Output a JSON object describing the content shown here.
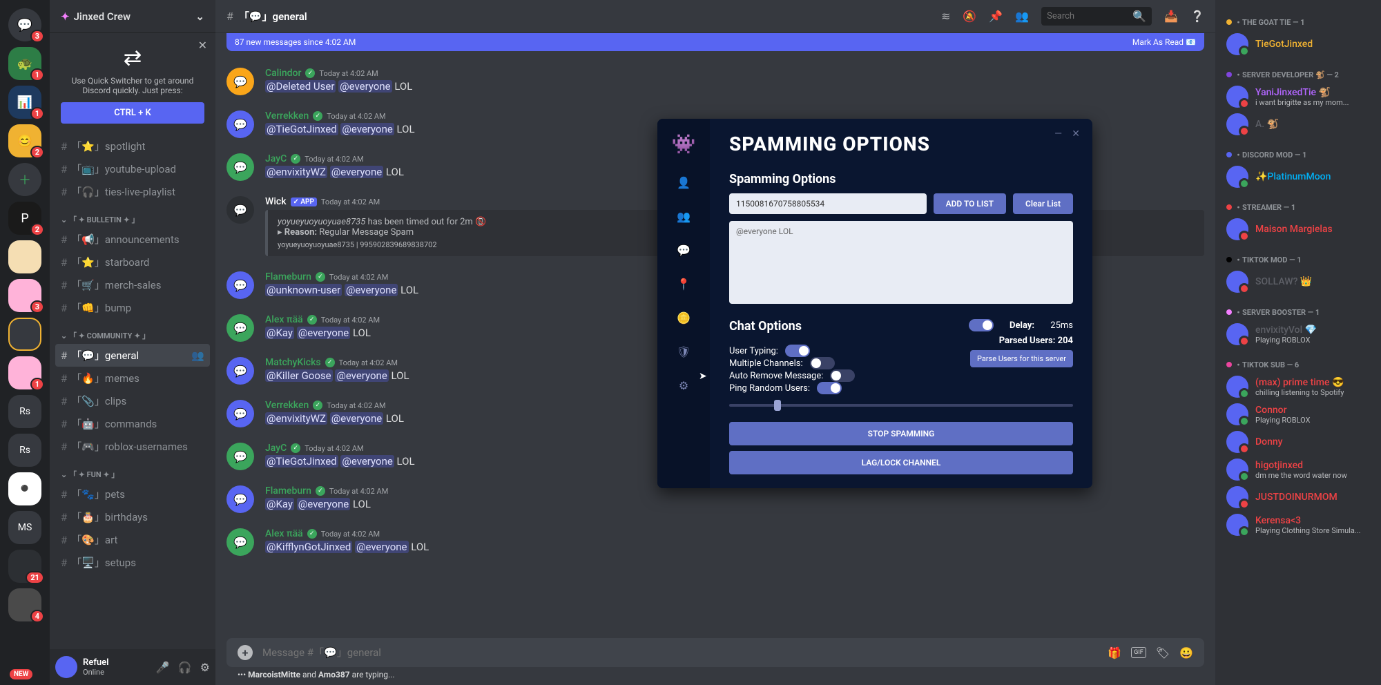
{
  "server_name": "Jinxed Crew",
  "quick_switcher": {
    "text": "Use Quick Switcher to get around Discord quickly. Just press:",
    "button": "CTRL + K"
  },
  "channels": {
    "top": [
      {
        "icon": "⭐",
        "name": "spotlight"
      },
      {
        "icon": "📺",
        "name": "youtube-upload"
      },
      {
        "icon": "🎧",
        "name": "ties-live-playlist"
      }
    ],
    "categories": [
      {
        "name": "「 ✦ BULLETIN ✦ 」",
        "items": [
          {
            "icon": "📢",
            "name": "announcements"
          },
          {
            "icon": "⭐",
            "name": "starboard"
          },
          {
            "icon": "🛒",
            "name": "merch-sales"
          },
          {
            "icon": "👊",
            "name": "bump"
          }
        ]
      },
      {
        "name": "「 ✦ COMMUNITY ✦ 」",
        "items": [
          {
            "icon": "💬",
            "name": "general",
            "active": true
          },
          {
            "icon": "🔥",
            "name": "memes"
          },
          {
            "icon": "📎",
            "name": "clips"
          },
          {
            "icon": "🤖",
            "name": "commands"
          },
          {
            "icon": "🎮",
            "name": "roblox-usernames"
          }
        ]
      },
      {
        "name": "「 ✦ FUN ✦ 」",
        "items": [
          {
            "icon": "🐾",
            "name": "pets"
          },
          {
            "icon": "🎂",
            "name": "birthdays"
          },
          {
            "icon": "🎨",
            "name": "art"
          },
          {
            "icon": "🖥️",
            "name": "setups"
          }
        ]
      }
    ]
  },
  "current_user": {
    "name": "Refuel",
    "status": "Online"
  },
  "channel_header": {
    "prefix": "#",
    "title": "「💬」general"
  },
  "search_placeholder": "Search",
  "new_messages": {
    "text": "87 new messages since 4:02 AM",
    "action": "Mark As Read"
  },
  "messages": [
    {
      "author": "Calindor",
      "color": "#3ba55c",
      "time": "Today at 4:02 AM",
      "mentions": [
        "@Deleted User",
        "@everyone"
      ],
      "text": "LOL",
      "avatar": "#faa61a"
    },
    {
      "author": "Verrekken",
      "color": "#3ba55c",
      "time": "Today at 4:02 AM",
      "mentions": [
        "@TieGotJinxed",
        "@everyone"
      ],
      "text": "LOL",
      "avatar": "#5865f2"
    },
    {
      "author": "JayC",
      "color": "#3ba55c",
      "time": "Today at 4:02 AM",
      "mentions": [
        "@envixityWZ",
        "@everyone"
      ],
      "text": "LOL",
      "avatar": "#3ba55c"
    },
    {
      "author": "Wick",
      "color": "#fff",
      "time": "Today at 4:02 AM",
      "app": true,
      "embed": {
        "line1_italic": "yoyueyuoyuoyuae8735",
        "line1_rest": " has been timed out for 2m 📵",
        "reason_label": "Reason:",
        "reason": " Regular Message Spam",
        "footer": "yoyueyuoyuoyuae8735 | 995902839689838702"
      },
      "avatar": "#2c2f33"
    },
    {
      "author": "Flameburn",
      "color": "#3ba55c",
      "time": "Today at 4:02 AM",
      "mentions": [
        "@unknown-user",
        "@everyone"
      ],
      "text": "LOL",
      "avatar": "#5865f2"
    },
    {
      "author": "Alex πää",
      "color": "#3ba55c",
      "time": "Today at 4:02 AM",
      "mentions": [
        "@Kay",
        "@everyone"
      ],
      "text": "LOL",
      "avatar": "#3ba55c"
    },
    {
      "author": "MatchyKicks",
      "color": "#3ba55c",
      "time": "Today at 4:02 AM",
      "mentions": [
        "@Killer Goose",
        "@everyone"
      ],
      "text": "LOL",
      "avatar": "#5865f2"
    },
    {
      "author": "Verrekken",
      "color": "#3ba55c",
      "time": "Today at 4:02 AM",
      "mentions": [
        "@envixityWZ",
        "@everyone"
      ],
      "text": "LOL",
      "avatar": "#5865f2"
    },
    {
      "author": "JayC",
      "color": "#3ba55c",
      "time": "Today at 4:02 AM",
      "mentions": [
        "@TieGotJinxed",
        "@everyone"
      ],
      "text": "LOL",
      "avatar": "#3ba55c"
    },
    {
      "author": "Flameburn",
      "color": "#3ba55c",
      "time": "Today at 4:02 AM",
      "mentions": [
        "@Kay",
        "@everyone"
      ],
      "text": "LOL",
      "avatar": "#5865f2"
    },
    {
      "author": "Alex πää",
      "color": "#3ba55c",
      "time": "Today at 4:02 AM",
      "mentions": [
        "@KifflynGotJinxed",
        "@everyone"
      ],
      "text": "LOL",
      "avatar": "#3ba55c"
    }
  ],
  "input_placeholder": "Message #「💬」general",
  "typing": "••• MarcoistMitte and Amo387 are typing...",
  "modal": {
    "title": "SPAMMING OPTIONS",
    "section1": "Spamming Options",
    "id_value": "1150081670758805534",
    "add_btn": "ADD TO LIST",
    "clear_btn": "Clear List",
    "textarea_value": "@everyone LOL",
    "section2": "Chat Options",
    "opts": [
      {
        "label": "User Typing:",
        "on": true
      },
      {
        "label": "Multiple Channels:",
        "on": false
      },
      {
        "label": "Auto Remove Message:",
        "on": false
      },
      {
        "label": "Ping Random Users:",
        "on": true
      }
    ],
    "delay_label": "Delay:",
    "delay_value": "25ms",
    "parsed_label": "Parsed Users:",
    "parsed_value": "204",
    "parse_btn": "Parse Users for this server",
    "stop_btn": "STOP SPAMMING",
    "lag_btn": "LAG/LOCK CHANNEL"
  },
  "members": {
    "roles": [
      {
        "name": "THE GOAT TIE — 1",
        "color": "#f0b232",
        "dot": "#f0b232",
        "members": [
          {
            "name": "TieGotJinxed",
            "color": "#f0b232",
            "status": "",
            "presence": "online"
          }
        ]
      },
      {
        "name": "SERVER DEVELOPER 🐒 — 2",
        "color": "#8e9297",
        "dot": "#8045dd",
        "members": [
          {
            "name": "YaniJinxedTie",
            "color": "#b266ff",
            "status": "i want brigitte as my mom...",
            "presence": "dnd",
            "badge": "🐒"
          },
          {
            "name": "A.",
            "color": "#5d5f66",
            "status": "",
            "presence": "dnd",
            "badge": "🐒"
          }
        ]
      },
      {
        "name": "DISCORD MOD — 1",
        "color": "#8e9297",
        "dot": "#5865f2",
        "members": [
          {
            "name": "✨PlatinumMoon",
            "color": "#00aff4",
            "status": "",
            "presence": "online"
          }
        ]
      },
      {
        "name": "STREAMER — 1",
        "color": "#8e9297",
        "dot": "#ed4245",
        "members": [
          {
            "name": "Maison Margielas",
            "color": "#ed4245",
            "status": "",
            "presence": "dnd"
          }
        ]
      },
      {
        "name": "TIKTOK MOD — 1",
        "color": "#8e9297",
        "dot": "#000",
        "members": [
          {
            "name": "SOLLAW?",
            "color": "#5d5f66",
            "status": "",
            "presence": "dnd",
            "badge": "👑"
          }
        ]
      },
      {
        "name": "SERVER BOOSTER — 1",
        "color": "#8e9297",
        "dot": "#f47fff",
        "members": [
          {
            "name": "envixityVol",
            "color": "#5d5f66",
            "status": "Playing ROBLOX",
            "presence": "dnd",
            "badge": "💎"
          }
        ]
      },
      {
        "name": "TIKTOK SUB — 6",
        "color": "#8e9297",
        "dot": "#eb459e",
        "members": [
          {
            "name": "(max) prime time 😎",
            "color": "#ed4245",
            "status": "chilling listening to Spotify",
            "presence": "online"
          },
          {
            "name": "Connor",
            "color": "#ed4245",
            "status": "Playing ROBLOX",
            "presence": "online"
          },
          {
            "name": "Donny",
            "color": "#ed4245",
            "status": "",
            "presence": "dnd"
          },
          {
            "name": "higotjinxed",
            "color": "#ed4245",
            "status": "dm me the word water now",
            "presence": "online"
          },
          {
            "name": "JUSTDOINURMOM",
            "color": "#ed4245",
            "status": "",
            "presence": "dnd"
          },
          {
            "name": "Kerensa<3",
            "color": "#ed4245",
            "status": "Playing Clothing Store Simula...",
            "presence": "online"
          }
        ]
      }
    ]
  },
  "server_badges": [
    "1",
    "1",
    "2",
    "",
    "2",
    "",
    "",
    "3",
    "",
    "1",
    "",
    "",
    "",
    "",
    "21",
    ""
  ],
  "new_label": "NEW"
}
